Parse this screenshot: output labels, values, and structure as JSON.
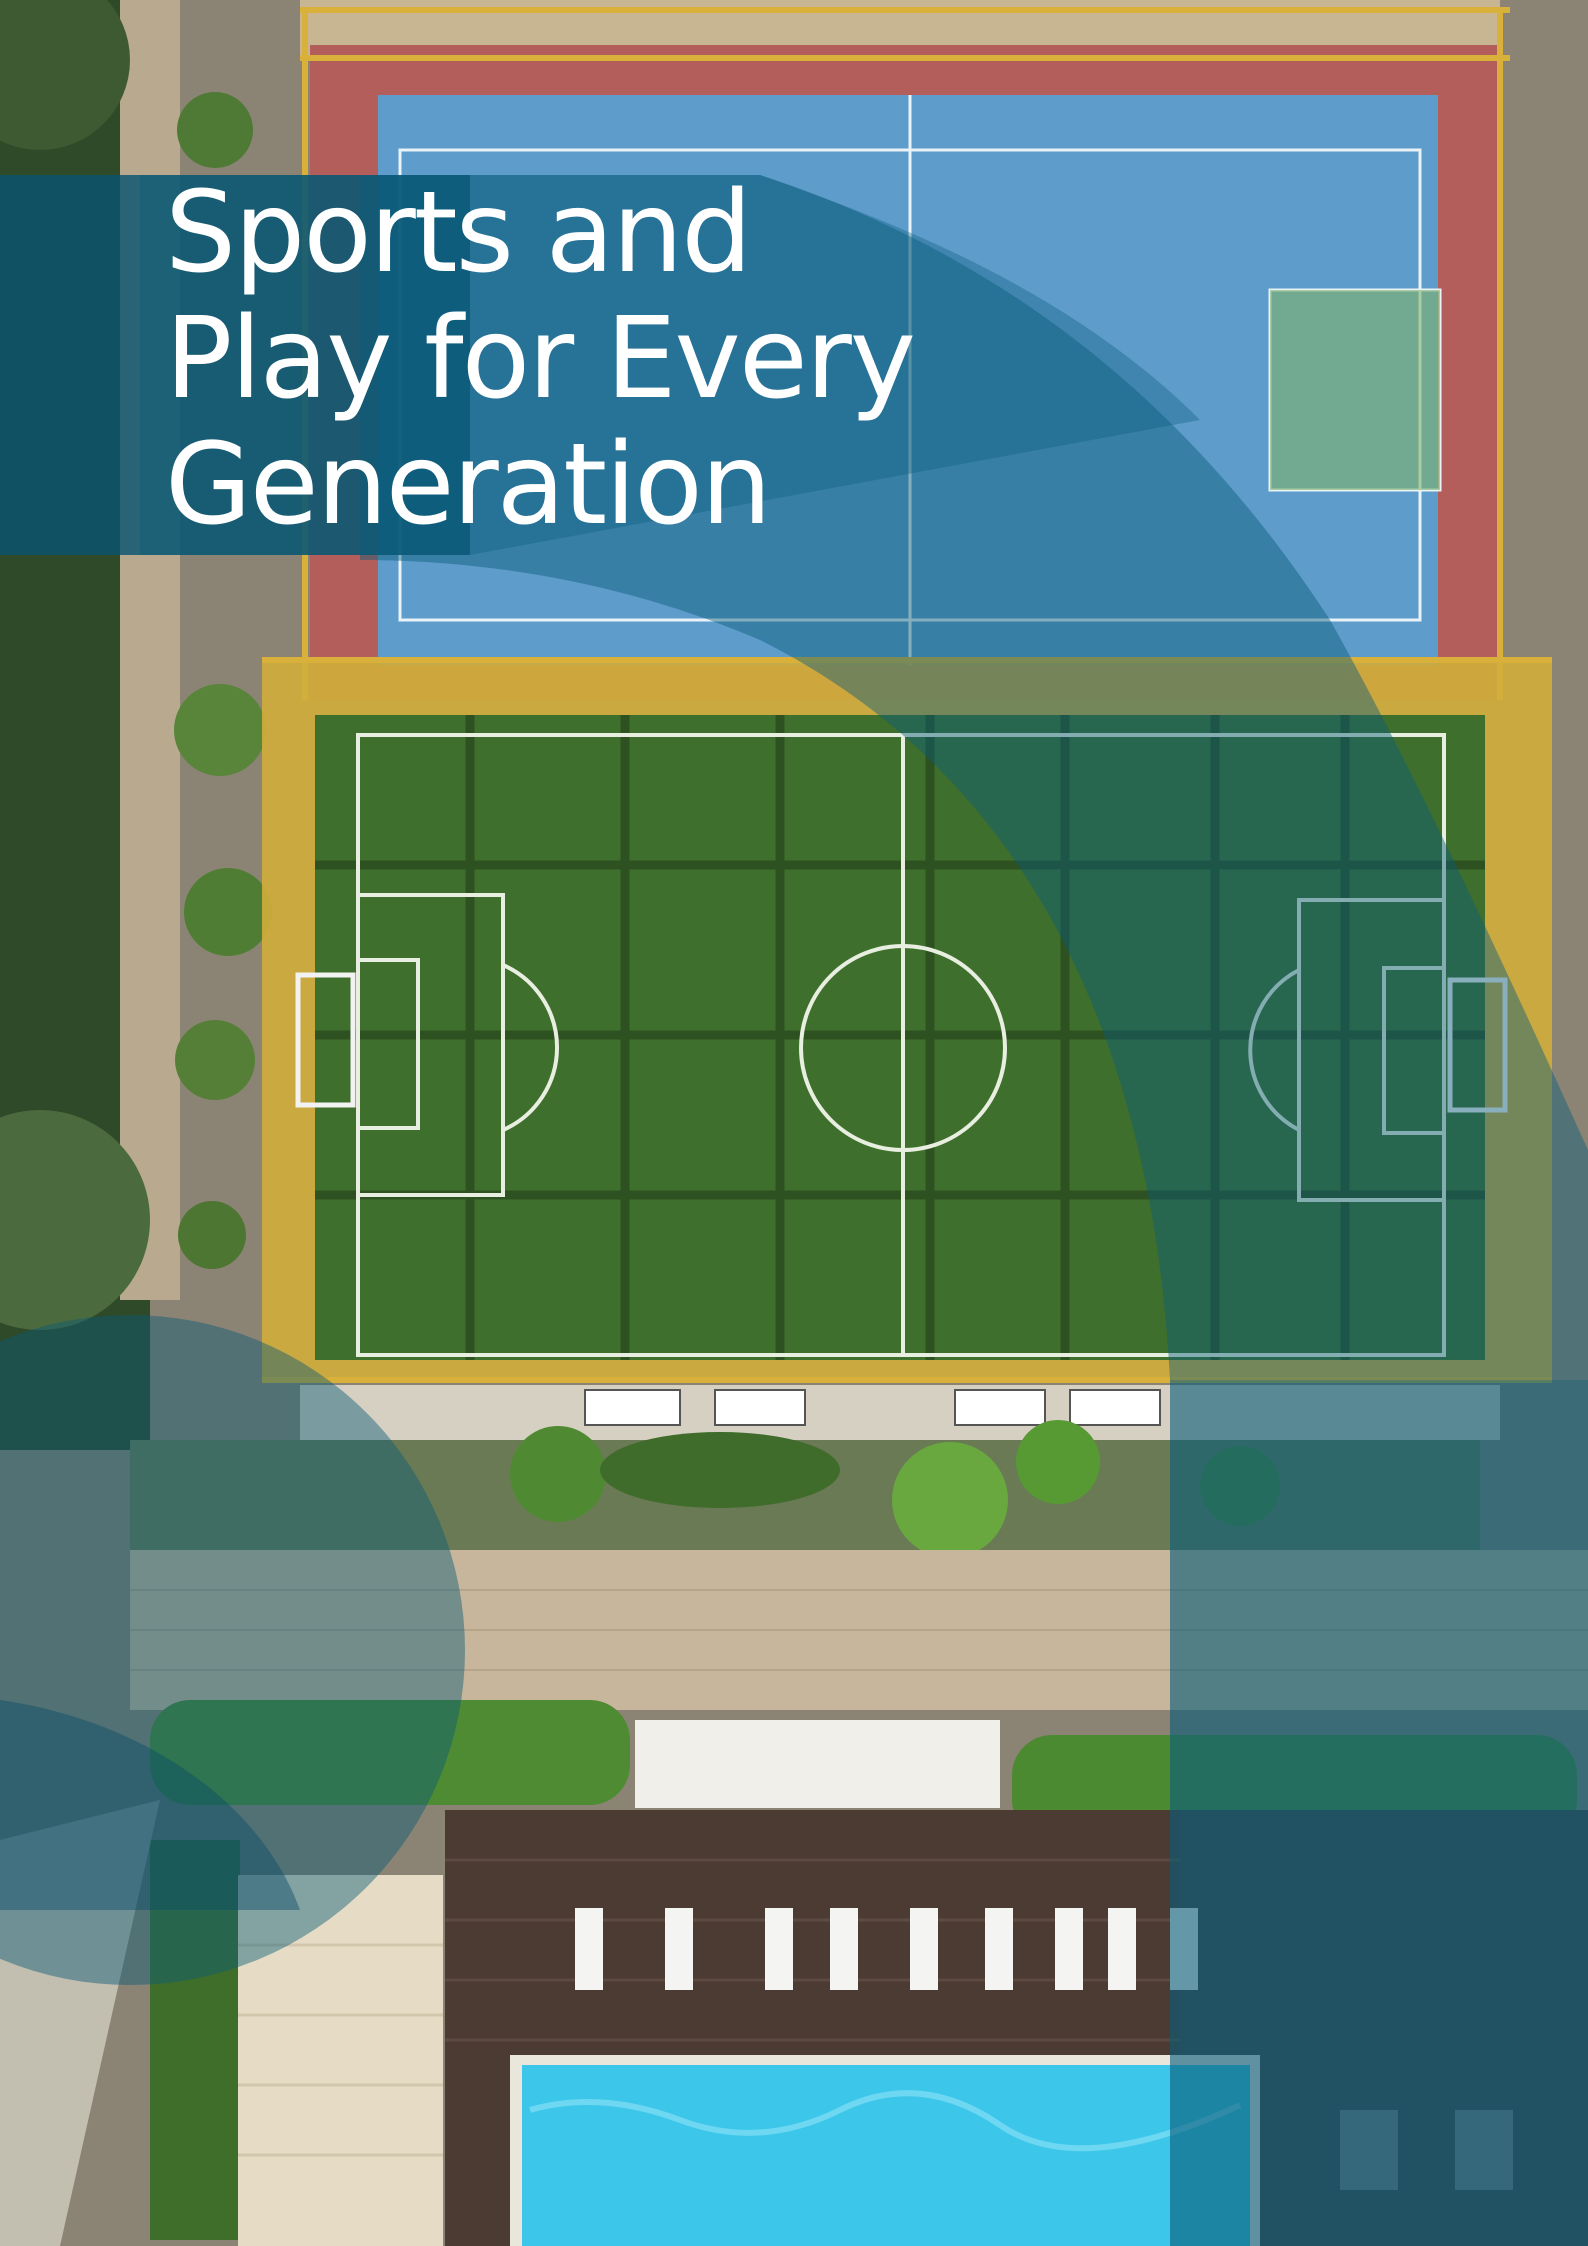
{
  "poster": {
    "title": "Sports and\nPlay for Every\nGeneration"
  },
  "colors": {
    "overlay_teal": "#0b5c74",
    "overlay_deep": "#073c52",
    "turf": "#3d6a2c",
    "court_blue": "#5b9ac6",
    "court_red": "#b25a58",
    "pool": "#38c2e6",
    "text": "#ffffff"
  }
}
